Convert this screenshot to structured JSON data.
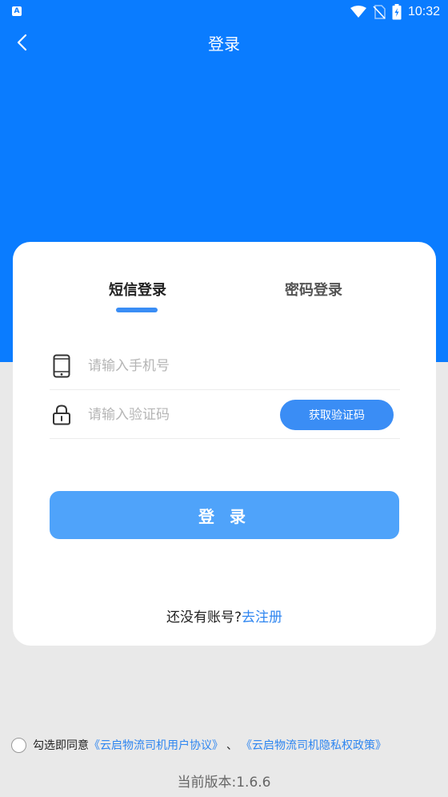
{
  "status_bar": {
    "app_badge": "A",
    "time": "10:32"
  },
  "nav": {
    "title": "登录"
  },
  "tabs": {
    "sms": "短信登录",
    "password": "密码登录"
  },
  "form": {
    "phone_placeholder": "请输入手机号",
    "code_placeholder": "请输入验证码",
    "get_code_label": "获取验证码",
    "login_label": "登 录"
  },
  "register": {
    "prompt": "还没有账号?",
    "link": "去注册"
  },
  "agreement": {
    "prefix": "勾选即同意",
    "user_agreement": "《云启物流司机用户协议》",
    "separator": "、",
    "privacy_policy": "《云启物流司机隐私权政策》"
  },
  "version": {
    "label": "当前版本:",
    "value": "1.6.6"
  },
  "colors": {
    "brand_blue": "#0a7cff",
    "button_blue": "#4fa3fa",
    "link_blue": "#2f86f0"
  }
}
